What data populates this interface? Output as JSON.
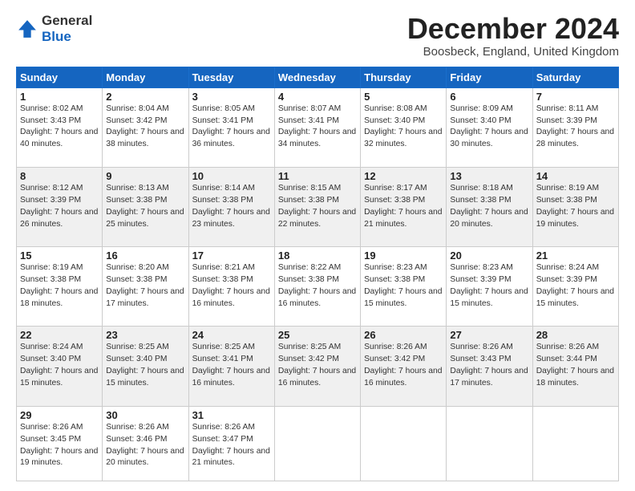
{
  "header": {
    "logo_line1": "General",
    "logo_line2": "Blue",
    "month_title": "December 2024",
    "location": "Boosbeck, England, United Kingdom"
  },
  "weekdays": [
    "Sunday",
    "Monday",
    "Tuesday",
    "Wednesday",
    "Thursday",
    "Friday",
    "Saturday"
  ],
  "weeks": [
    [
      {
        "day": "1",
        "sunrise": "Sunrise: 8:02 AM",
        "sunset": "Sunset: 3:43 PM",
        "daylight": "Daylight: 7 hours and 40 minutes."
      },
      {
        "day": "2",
        "sunrise": "Sunrise: 8:04 AM",
        "sunset": "Sunset: 3:42 PM",
        "daylight": "Daylight: 7 hours and 38 minutes."
      },
      {
        "day": "3",
        "sunrise": "Sunrise: 8:05 AM",
        "sunset": "Sunset: 3:41 PM",
        "daylight": "Daylight: 7 hours and 36 minutes."
      },
      {
        "day": "4",
        "sunrise": "Sunrise: 8:07 AM",
        "sunset": "Sunset: 3:41 PM",
        "daylight": "Daylight: 7 hours and 34 minutes."
      },
      {
        "day": "5",
        "sunrise": "Sunrise: 8:08 AM",
        "sunset": "Sunset: 3:40 PM",
        "daylight": "Daylight: 7 hours and 32 minutes."
      },
      {
        "day": "6",
        "sunrise": "Sunrise: 8:09 AM",
        "sunset": "Sunset: 3:40 PM",
        "daylight": "Daylight: 7 hours and 30 minutes."
      },
      {
        "day": "7",
        "sunrise": "Sunrise: 8:11 AM",
        "sunset": "Sunset: 3:39 PM",
        "daylight": "Daylight: 7 hours and 28 minutes."
      }
    ],
    [
      {
        "day": "8",
        "sunrise": "Sunrise: 8:12 AM",
        "sunset": "Sunset: 3:39 PM",
        "daylight": "Daylight: 7 hours and 26 minutes."
      },
      {
        "day": "9",
        "sunrise": "Sunrise: 8:13 AM",
        "sunset": "Sunset: 3:38 PM",
        "daylight": "Daylight: 7 hours and 25 minutes."
      },
      {
        "day": "10",
        "sunrise": "Sunrise: 8:14 AM",
        "sunset": "Sunset: 3:38 PM",
        "daylight": "Daylight: 7 hours and 23 minutes."
      },
      {
        "day": "11",
        "sunrise": "Sunrise: 8:15 AM",
        "sunset": "Sunset: 3:38 PM",
        "daylight": "Daylight: 7 hours and 22 minutes."
      },
      {
        "day": "12",
        "sunrise": "Sunrise: 8:17 AM",
        "sunset": "Sunset: 3:38 PM",
        "daylight": "Daylight: 7 hours and 21 minutes."
      },
      {
        "day": "13",
        "sunrise": "Sunrise: 8:18 AM",
        "sunset": "Sunset: 3:38 PM",
        "daylight": "Daylight: 7 hours and 20 minutes."
      },
      {
        "day": "14",
        "sunrise": "Sunrise: 8:19 AM",
        "sunset": "Sunset: 3:38 PM",
        "daylight": "Daylight: 7 hours and 19 minutes."
      }
    ],
    [
      {
        "day": "15",
        "sunrise": "Sunrise: 8:19 AM",
        "sunset": "Sunset: 3:38 PM",
        "daylight": "Daylight: 7 hours and 18 minutes."
      },
      {
        "day": "16",
        "sunrise": "Sunrise: 8:20 AM",
        "sunset": "Sunset: 3:38 PM",
        "daylight": "Daylight: 7 hours and 17 minutes."
      },
      {
        "day": "17",
        "sunrise": "Sunrise: 8:21 AM",
        "sunset": "Sunset: 3:38 PM",
        "daylight": "Daylight: 7 hours and 16 minutes."
      },
      {
        "day": "18",
        "sunrise": "Sunrise: 8:22 AM",
        "sunset": "Sunset: 3:38 PM",
        "daylight": "Daylight: 7 hours and 16 minutes."
      },
      {
        "day": "19",
        "sunrise": "Sunrise: 8:23 AM",
        "sunset": "Sunset: 3:38 PM",
        "daylight": "Daylight: 7 hours and 15 minutes."
      },
      {
        "day": "20",
        "sunrise": "Sunrise: 8:23 AM",
        "sunset": "Sunset: 3:39 PM",
        "daylight": "Daylight: 7 hours and 15 minutes."
      },
      {
        "day": "21",
        "sunrise": "Sunrise: 8:24 AM",
        "sunset": "Sunset: 3:39 PM",
        "daylight": "Daylight: 7 hours and 15 minutes."
      }
    ],
    [
      {
        "day": "22",
        "sunrise": "Sunrise: 8:24 AM",
        "sunset": "Sunset: 3:40 PM",
        "daylight": "Daylight: 7 hours and 15 minutes."
      },
      {
        "day": "23",
        "sunrise": "Sunrise: 8:25 AM",
        "sunset": "Sunset: 3:40 PM",
        "daylight": "Daylight: 7 hours and 15 minutes."
      },
      {
        "day": "24",
        "sunrise": "Sunrise: 8:25 AM",
        "sunset": "Sunset: 3:41 PM",
        "daylight": "Daylight: 7 hours and 16 minutes."
      },
      {
        "day": "25",
        "sunrise": "Sunrise: 8:25 AM",
        "sunset": "Sunset: 3:42 PM",
        "daylight": "Daylight: 7 hours and 16 minutes."
      },
      {
        "day": "26",
        "sunrise": "Sunrise: 8:26 AM",
        "sunset": "Sunset: 3:42 PM",
        "daylight": "Daylight: 7 hours and 16 minutes."
      },
      {
        "day": "27",
        "sunrise": "Sunrise: 8:26 AM",
        "sunset": "Sunset: 3:43 PM",
        "daylight": "Daylight: 7 hours and 17 minutes."
      },
      {
        "day": "28",
        "sunrise": "Sunrise: 8:26 AM",
        "sunset": "Sunset: 3:44 PM",
        "daylight": "Daylight: 7 hours and 18 minutes."
      }
    ],
    [
      {
        "day": "29",
        "sunrise": "Sunrise: 8:26 AM",
        "sunset": "Sunset: 3:45 PM",
        "daylight": "Daylight: 7 hours and 19 minutes."
      },
      {
        "day": "30",
        "sunrise": "Sunrise: 8:26 AM",
        "sunset": "Sunset: 3:46 PM",
        "daylight": "Daylight: 7 hours and 20 minutes."
      },
      {
        "day": "31",
        "sunrise": "Sunrise: 8:26 AM",
        "sunset": "Sunset: 3:47 PM",
        "daylight": "Daylight: 7 hours and 21 minutes."
      },
      null,
      null,
      null,
      null
    ]
  ]
}
